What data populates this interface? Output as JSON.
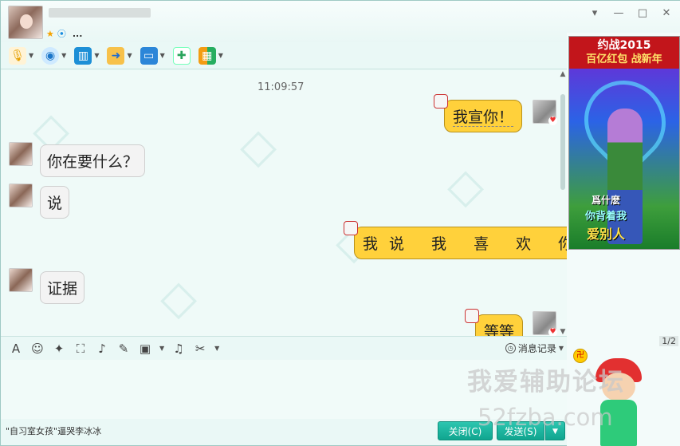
{
  "window": {
    "controls": {
      "skin": "▾",
      "minimize": "—",
      "maximize": "□",
      "close": "✕"
    }
  },
  "header": {
    "contact_name": "",
    "status_more": "..."
  },
  "toolbar": {
    "icons": [
      "microphone-icon",
      "camera-icon",
      "screen-share-icon",
      "file-transfer-icon",
      "remote-desktop-icon",
      "message-icon",
      "apps-icon"
    ]
  },
  "chat": {
    "timestamp": "11:09:57",
    "messages": [
      {
        "from": "me",
        "text": "我宣你！"
      },
      {
        "from": "them",
        "text": "你在要什么？"
      },
      {
        "from": "them",
        "text": "说"
      },
      {
        "from": "me",
        "text": "我说 我 喜 欢 你"
      },
      {
        "from": "them",
        "text": "证据"
      },
      {
        "from": "me",
        "text": "等等"
      }
    ]
  },
  "input_toolbar": {
    "history_label": "消息记录"
  },
  "bottom": {
    "signature": "\"自习室女孩\"逼哭李冰冰",
    "close_label": "关闭(C)",
    "send_label": "发送(S)"
  },
  "ad": {
    "line1": "约战2015",
    "line2": "百亿红包 战新年",
    "text1": "爲什麽",
    "text2": "你背着我",
    "text3": "爱别人"
  },
  "right_panel": {
    "page_indicator": "1/2"
  },
  "watermark": {
    "line1": "我爱辅助论坛",
    "line2": "52fzba.com"
  },
  "colors": {
    "accent": "#10a58f",
    "bubble_out": "#ffd13b",
    "bubble_in": "#f3f3f3"
  }
}
